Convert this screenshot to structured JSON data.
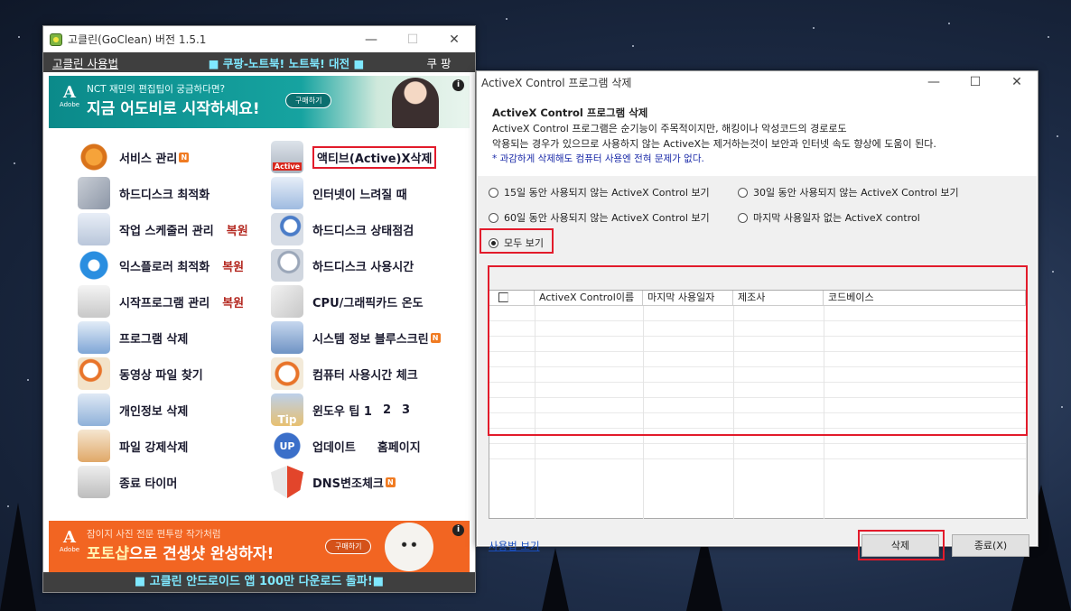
{
  "goclean": {
    "title": "고클린(GoClean) 버전 1.5.1",
    "menu": {
      "left": "고클린 사용법",
      "center": "■ 쿠팡-노트북! 노트북! 대전 ■",
      "right": "쿠 팡"
    },
    "banner_top": {
      "small": "NCT 재민의 편집팁이 궁금하다면?",
      "big": "지금 어도비로 시작하세요!",
      "button": "구매하기",
      "brand": "Adobe"
    },
    "items_left": [
      {
        "label": "서비스 관리",
        "badge": "N",
        "restore": ""
      },
      {
        "label": "하드디스크 최적화",
        "badge": "",
        "restore": ""
      },
      {
        "label": "작업 스케줄러 관리",
        "badge": "",
        "restore": "복원"
      },
      {
        "label": "익스플로러 최적화",
        "badge": "",
        "restore": "복원"
      },
      {
        "label": "시작프로그램 관리",
        "badge": "",
        "restore": "복원"
      },
      {
        "label": "프로그램 삭제",
        "badge": "",
        "restore": ""
      },
      {
        "label": "동영상 파일 찾기",
        "badge": "",
        "restore": ""
      },
      {
        "label": "개인정보 삭제",
        "badge": "",
        "restore": ""
      },
      {
        "label": "파일 강제삭제",
        "badge": "",
        "restore": ""
      },
      {
        "label": "종료 타이머",
        "badge": "",
        "restore": ""
      }
    ],
    "items_right": [
      {
        "label": "액티브(Active)X삭제",
        "badge": ""
      },
      {
        "label": "인터넷이 느려질 때",
        "badge": ""
      },
      {
        "label": "하드디스크 상태점검",
        "badge": ""
      },
      {
        "label": "하드디스크 사용시간",
        "badge": ""
      },
      {
        "label": "CPU/그래픽카드 온도",
        "badge": ""
      },
      {
        "label": "시스템 정보 블루스크린",
        "badge": "N"
      },
      {
        "label": "컴퓨터 사용시간 체크",
        "badge": ""
      },
      {
        "label": "윈도우 팁 1",
        "badge": "",
        "extra": [
          "2",
          "3"
        ]
      },
      {
        "label": "업데이트",
        "badge": "",
        "extra": [
          "홈페이지"
        ]
      },
      {
        "label": "DNS변조체크",
        "badge": "N"
      }
    ],
    "active_icon_text": "Active",
    "tip_icon_text": "Tip",
    "up_icon_text": "UP",
    "banner_bottom": {
      "small": "잠이지 사진 전문 편투랑 작가처럼",
      "big_accent": "포토샵",
      "big": "으로 견생샷 완성하자!",
      "button": "구매하기",
      "brand": "Adobe"
    },
    "footer": "■ 고클린 안드로이드 앱 100만 다운로드 돌파!■"
  },
  "activex": {
    "title": "ActiveX Control 프로그램 삭제",
    "heading": "ActiveX Control 프로그램 삭제",
    "desc1": "ActiveX Control 프로그램은 순기능이 주목적이지만, 해킹이나 악성코드의 경로로도",
    "desc2": "악용되는 경우가 있으므로 사용하지 않는 ActiveX는 제거하는것이 보안과 인터넷 속도 향상에 도움이 된다.",
    "note": "* 과감하게 삭제해도 컴퓨터 사용엔 전혀 문제가 없다.",
    "radios": [
      "15일 동안 사용되지 않는 ActiveX Control 보기",
      "30일 동안 사용되지 않는 ActiveX Control 보기",
      "60일 동안 사용되지 않는 ActiveX Control 보기",
      "마지막 사용일자 없는 ActiveX control",
      "모두 보기"
    ],
    "selected_radio": "모두 보기",
    "columns": [
      "ActiveX Control이름",
      "마지막 사용일자",
      "제조사",
      "코드베이스"
    ],
    "help_link": "사용법 보기",
    "delete_btn": "삭제",
    "close_btn": "종료(X)"
  },
  "window_buttons": {
    "min": "—",
    "max": "☐",
    "close": "✕"
  }
}
